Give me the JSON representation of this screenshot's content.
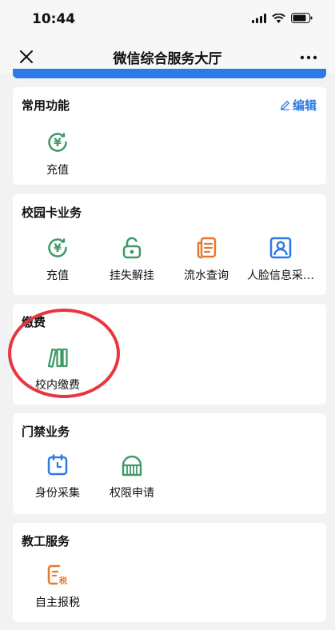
{
  "status_bar": {
    "time": "10:44"
  },
  "nav": {
    "title": "微信综合服务大厅"
  },
  "sections": [
    {
      "title": "常用功能",
      "edit_label": "编辑",
      "items": [
        {
          "label": "充值",
          "icon": "yuan-icon",
          "color": "#3f9a68"
        }
      ]
    },
    {
      "title": "校园卡业务",
      "items": [
        {
          "label": "充值",
          "icon": "yuan-icon",
          "color": "#3f9a68"
        },
        {
          "label": "挂失解挂",
          "icon": "unlock-icon",
          "color": "#3f9a68"
        },
        {
          "label": "流水查询",
          "icon": "document-icon",
          "color": "#e8772e"
        },
        {
          "label": "人脸信息采…",
          "icon": "person-card-icon",
          "color": "#2c7be5"
        }
      ]
    },
    {
      "title": "缴费",
      "items": [
        {
          "label": "校内缴费",
          "icon": "books-icon",
          "color": "#3f9a68"
        }
      ]
    },
    {
      "title": "门禁业务",
      "items": [
        {
          "label": "身份采集",
          "icon": "clock-card-icon",
          "color": "#2c7be5"
        },
        {
          "label": "权限申请",
          "icon": "gate-icon",
          "color": "#3f9a68"
        }
      ]
    },
    {
      "title": "教工服务",
      "items": [
        {
          "label": "自主报税",
          "icon": "tax-icon",
          "color": "#e8772e",
          "badge": "税"
        }
      ]
    }
  ],
  "colors": {
    "accent": "#2c7be5",
    "annotation": "#e8363f"
  }
}
